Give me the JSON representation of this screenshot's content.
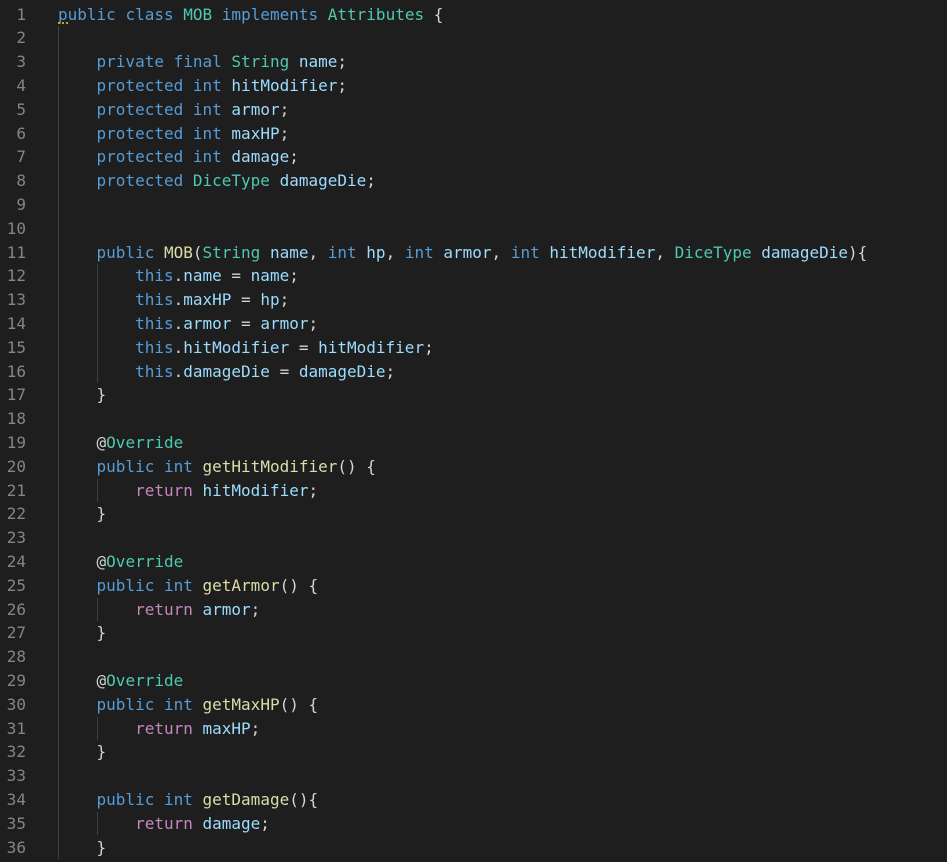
{
  "editor": {
    "language": "Java",
    "colors": {
      "background": "#1e1e1e",
      "keyword": "#569cd6",
      "control_keyword": "#c586c0",
      "type": "#4ec9b0",
      "variable": "#9cdcfe",
      "function": "#dcdcaa",
      "punctuation": "#d4d4d4",
      "line_number": "#858585",
      "warning_squiggle": "#cca700"
    },
    "warning_marker": {
      "line": 1,
      "icon": "warning-squiggle"
    },
    "lines": [
      {
        "n": "1",
        "tokens": [
          [
            "public",
            "k"
          ],
          [
            " ",
            "p"
          ],
          [
            "class",
            "k"
          ],
          [
            " ",
            "p"
          ],
          [
            "MOB",
            "t"
          ],
          [
            " ",
            "p"
          ],
          [
            "implements",
            "k"
          ],
          [
            " ",
            "p"
          ],
          [
            "Attributes",
            "t"
          ],
          [
            " {",
            "p"
          ]
        ]
      },
      {
        "n": "2",
        "tokens": []
      },
      {
        "n": "3",
        "tokens": [
          [
            "    ",
            "p"
          ],
          [
            "private",
            "k"
          ],
          [
            " ",
            "p"
          ],
          [
            "final",
            "k"
          ],
          [
            " ",
            "p"
          ],
          [
            "String",
            "t"
          ],
          [
            " ",
            "p"
          ],
          [
            "name",
            "v"
          ],
          [
            ";",
            "p"
          ]
        ]
      },
      {
        "n": "4",
        "tokens": [
          [
            "    ",
            "p"
          ],
          [
            "protected",
            "k"
          ],
          [
            " ",
            "p"
          ],
          [
            "int",
            "k"
          ],
          [
            " ",
            "p"
          ],
          [
            "hitModifier",
            "v"
          ],
          [
            ";",
            "p"
          ]
        ]
      },
      {
        "n": "5",
        "tokens": [
          [
            "    ",
            "p"
          ],
          [
            "protected",
            "k"
          ],
          [
            " ",
            "p"
          ],
          [
            "int",
            "k"
          ],
          [
            " ",
            "p"
          ],
          [
            "armor",
            "v"
          ],
          [
            ";",
            "p"
          ]
        ]
      },
      {
        "n": "6",
        "tokens": [
          [
            "    ",
            "p"
          ],
          [
            "protected",
            "k"
          ],
          [
            " ",
            "p"
          ],
          [
            "int",
            "k"
          ],
          [
            " ",
            "p"
          ],
          [
            "maxHP",
            "v"
          ],
          [
            ";",
            "p"
          ]
        ]
      },
      {
        "n": "7",
        "tokens": [
          [
            "    ",
            "p"
          ],
          [
            "protected",
            "k"
          ],
          [
            " ",
            "p"
          ],
          [
            "int",
            "k"
          ],
          [
            " ",
            "p"
          ],
          [
            "damage",
            "v"
          ],
          [
            ";",
            "p"
          ]
        ]
      },
      {
        "n": "8",
        "tokens": [
          [
            "    ",
            "p"
          ],
          [
            "protected",
            "k"
          ],
          [
            " ",
            "p"
          ],
          [
            "DiceType",
            "t"
          ],
          [
            " ",
            "p"
          ],
          [
            "damageDie",
            "v"
          ],
          [
            ";",
            "p"
          ]
        ]
      },
      {
        "n": "9",
        "tokens": []
      },
      {
        "n": "10",
        "tokens": []
      },
      {
        "n": "11",
        "tokens": [
          [
            "    ",
            "p"
          ],
          [
            "public",
            "k"
          ],
          [
            " ",
            "p"
          ],
          [
            "MOB",
            "f"
          ],
          [
            "(",
            "p"
          ],
          [
            "String",
            "t"
          ],
          [
            " ",
            "p"
          ],
          [
            "name",
            "v"
          ],
          [
            ", ",
            "p"
          ],
          [
            "int",
            "k"
          ],
          [
            " ",
            "p"
          ],
          [
            "hp",
            "v"
          ],
          [
            ", ",
            "p"
          ],
          [
            "int",
            "k"
          ],
          [
            " ",
            "p"
          ],
          [
            "armor",
            "v"
          ],
          [
            ", ",
            "p"
          ],
          [
            "int",
            "k"
          ],
          [
            " ",
            "p"
          ],
          [
            "hitModifier",
            "v"
          ],
          [
            ", ",
            "p"
          ],
          [
            "DiceType",
            "t"
          ],
          [
            " ",
            "p"
          ],
          [
            "damageDie",
            "v"
          ],
          [
            "){",
            "p"
          ]
        ]
      },
      {
        "n": "12",
        "tokens": [
          [
            "        ",
            "p"
          ],
          [
            "this",
            "k"
          ],
          [
            ".",
            "p"
          ],
          [
            "name",
            "v"
          ],
          [
            " = ",
            "p"
          ],
          [
            "name",
            "v"
          ],
          [
            ";",
            "p"
          ]
        ]
      },
      {
        "n": "13",
        "tokens": [
          [
            "        ",
            "p"
          ],
          [
            "this",
            "k"
          ],
          [
            ".",
            "p"
          ],
          [
            "maxHP",
            "v"
          ],
          [
            " = ",
            "p"
          ],
          [
            "hp",
            "v"
          ],
          [
            ";",
            "p"
          ]
        ]
      },
      {
        "n": "14",
        "tokens": [
          [
            "        ",
            "p"
          ],
          [
            "this",
            "k"
          ],
          [
            ".",
            "p"
          ],
          [
            "armor",
            "v"
          ],
          [
            " = ",
            "p"
          ],
          [
            "armor",
            "v"
          ],
          [
            ";",
            "p"
          ]
        ]
      },
      {
        "n": "15",
        "tokens": [
          [
            "        ",
            "p"
          ],
          [
            "this",
            "k"
          ],
          [
            ".",
            "p"
          ],
          [
            "hitModifier",
            "v"
          ],
          [
            " = ",
            "p"
          ],
          [
            "hitModifier",
            "v"
          ],
          [
            ";",
            "p"
          ]
        ]
      },
      {
        "n": "16",
        "tokens": [
          [
            "        ",
            "p"
          ],
          [
            "this",
            "k"
          ],
          [
            ".",
            "p"
          ],
          [
            "damageDie",
            "v"
          ],
          [
            " = ",
            "p"
          ],
          [
            "damageDie",
            "v"
          ],
          [
            ";",
            "p"
          ]
        ]
      },
      {
        "n": "17",
        "tokens": [
          [
            "    ",
            "p"
          ],
          [
            "}",
            "p"
          ]
        ]
      },
      {
        "n": "18",
        "tokens": []
      },
      {
        "n": "19",
        "tokens": [
          [
            "    ",
            "p"
          ],
          [
            "@",
            "a"
          ],
          [
            "Override",
            "t"
          ]
        ]
      },
      {
        "n": "20",
        "tokens": [
          [
            "    ",
            "p"
          ],
          [
            "public",
            "k"
          ],
          [
            " ",
            "p"
          ],
          [
            "int",
            "k"
          ],
          [
            " ",
            "p"
          ],
          [
            "getHitModifier",
            "f"
          ],
          [
            "() {",
            "p"
          ]
        ]
      },
      {
        "n": "21",
        "tokens": [
          [
            "        ",
            "p"
          ],
          [
            "return",
            "c"
          ],
          [
            " ",
            "p"
          ],
          [
            "hitModifier",
            "v"
          ],
          [
            ";",
            "p"
          ]
        ]
      },
      {
        "n": "22",
        "tokens": [
          [
            "    ",
            "p"
          ],
          [
            "}",
            "p"
          ]
        ]
      },
      {
        "n": "23",
        "tokens": []
      },
      {
        "n": "24",
        "tokens": [
          [
            "    ",
            "p"
          ],
          [
            "@",
            "a"
          ],
          [
            "Override",
            "t"
          ]
        ]
      },
      {
        "n": "25",
        "tokens": [
          [
            "    ",
            "p"
          ],
          [
            "public",
            "k"
          ],
          [
            " ",
            "p"
          ],
          [
            "int",
            "k"
          ],
          [
            " ",
            "p"
          ],
          [
            "getArmor",
            "f"
          ],
          [
            "() {",
            "p"
          ]
        ]
      },
      {
        "n": "26",
        "tokens": [
          [
            "        ",
            "p"
          ],
          [
            "return",
            "c"
          ],
          [
            " ",
            "p"
          ],
          [
            "armor",
            "v"
          ],
          [
            ";",
            "p"
          ]
        ]
      },
      {
        "n": "27",
        "tokens": [
          [
            "    ",
            "p"
          ],
          [
            "}",
            "p"
          ]
        ]
      },
      {
        "n": "28",
        "tokens": []
      },
      {
        "n": "29",
        "tokens": [
          [
            "    ",
            "p"
          ],
          [
            "@",
            "a"
          ],
          [
            "Override",
            "t"
          ]
        ]
      },
      {
        "n": "30",
        "tokens": [
          [
            "    ",
            "p"
          ],
          [
            "public",
            "k"
          ],
          [
            " ",
            "p"
          ],
          [
            "int",
            "k"
          ],
          [
            " ",
            "p"
          ],
          [
            "getMaxHP",
            "f"
          ],
          [
            "() {",
            "p"
          ]
        ]
      },
      {
        "n": "31",
        "tokens": [
          [
            "        ",
            "p"
          ],
          [
            "return",
            "c"
          ],
          [
            " ",
            "p"
          ],
          [
            "maxHP",
            "v"
          ],
          [
            ";",
            "p"
          ]
        ]
      },
      {
        "n": "32",
        "tokens": [
          [
            "    ",
            "p"
          ],
          [
            "}",
            "p"
          ]
        ]
      },
      {
        "n": "33",
        "tokens": []
      },
      {
        "n": "34",
        "tokens": [
          [
            "    ",
            "p"
          ],
          [
            "public",
            "k"
          ],
          [
            " ",
            "p"
          ],
          [
            "int",
            "k"
          ],
          [
            " ",
            "p"
          ],
          [
            "getDamage",
            "f"
          ],
          [
            "(){",
            "p"
          ]
        ]
      },
      {
        "n": "35",
        "tokens": [
          [
            "        ",
            "p"
          ],
          [
            "return",
            "c"
          ],
          [
            " ",
            "p"
          ],
          [
            "damage",
            "v"
          ],
          [
            ";",
            "p"
          ]
        ]
      },
      {
        "n": "36",
        "tokens": [
          [
            "    ",
            "p"
          ],
          [
            "}",
            "p"
          ]
        ]
      }
    ]
  }
}
